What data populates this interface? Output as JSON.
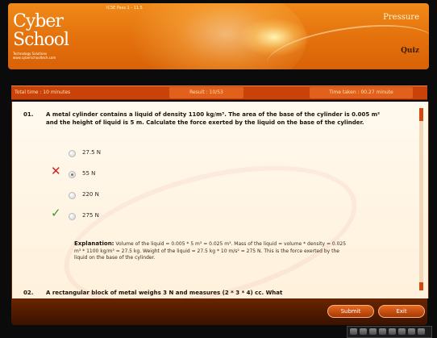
{
  "header": {
    "logo_line1": "Cyber",
    "logo_line2": "School",
    "logo_tagline": "Technology Solutions",
    "logo_url": "www.cyberschooltech.com",
    "level": "ICSE Pass 1 - 11.5",
    "topic": "Pressure",
    "mode": "Quiz"
  },
  "status": {
    "total_time": "Total time : 10 minutes",
    "result": "Result : 10/53",
    "time_taken": "Time taken : 00.27 minute"
  },
  "questions": [
    {
      "number": "01.",
      "text": "A metal cylinder contains a liquid of density 1100 kg/m³. The area of the base of the cylinder is 0.005 m² and the height of liquid is 5 m. Calculate the force exerted by the liquid on the base of the cylinder.",
      "options": [
        {
          "label": "27.5 N",
          "selected": false,
          "mark": ""
        },
        {
          "label": "55 N",
          "selected": true,
          "mark": "wrong"
        },
        {
          "label": "220 N",
          "selected": false,
          "mark": ""
        },
        {
          "label": "275 N",
          "selected": false,
          "mark": "correct"
        }
      ],
      "explanation_heading": "Explanation:",
      "explanation": "Volume of the liquid = 0.005 * 5 m³ = 0.025 m³. Mass of the liquid = volume * density = 0.025 m³ * 1100 kg/m³ = 27.5 kg. Weight of the liquid = 27.5 kg * 10 m/s² = 275 N. This is the force exerted by the liquid on the base of the cylinder."
    },
    {
      "number": "02.",
      "text": "A rectangular block of metal weighs 3 N and measures (2 * 3 * 4) cc. What"
    }
  ],
  "marks": {
    "wrong_symbol": "✕",
    "correct_symbol": "✓"
  },
  "footer": {
    "submit_label": "Submit",
    "exit_label": "Exit"
  },
  "colors": {
    "header_orange": "#e3700c",
    "status_bar": "#c8420a",
    "button": "#d05515",
    "panel_bg": "#fff6e8",
    "wrong": "#d02020",
    "correct": "#3e9a22"
  },
  "icons": [
    "close-icon",
    "check-icon",
    "scroll-up-icon",
    "scroll-down-icon"
  ]
}
